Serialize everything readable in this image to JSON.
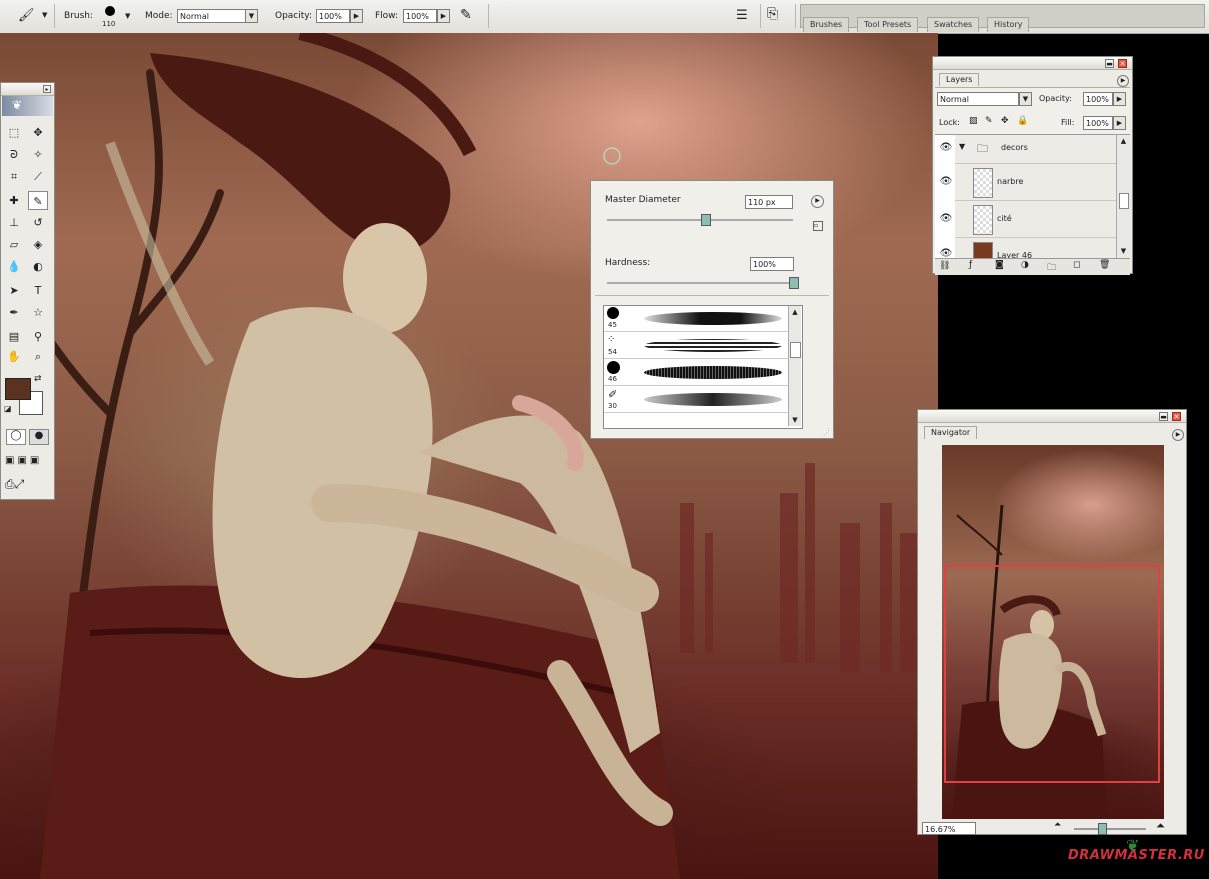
{
  "optionsbar": {
    "brush_label": "Brush:",
    "brush_size": "110",
    "mode_label": "Mode:",
    "mode_value": "Normal",
    "opacity_label": "Opacity:",
    "opacity_value": "100%",
    "flow_label": "Flow:",
    "flow_value": "100%",
    "well_tabs": [
      "Brushes",
      "Tool Presets",
      "Swatches",
      "History"
    ]
  },
  "brush_popup": {
    "master_diameter_label": "Master Diameter",
    "master_diameter_value": "110 px",
    "hardness_label": "Hardness:",
    "hardness_value": "100%",
    "presets": [
      {
        "size": "45"
      },
      {
        "size": "54"
      },
      {
        "size": "46"
      },
      {
        "size": "30"
      }
    ]
  },
  "layers": {
    "tab": "Layers",
    "blend_mode": "Normal",
    "opacity_label": "Opacity:",
    "opacity_value": "100%",
    "lock_label": "Lock:",
    "fill_label": "Fill:",
    "fill_value": "100%",
    "items": [
      {
        "name": "decors"
      },
      {
        "name": "narbre"
      },
      {
        "name": "cité"
      },
      {
        "name": "Layer 46"
      }
    ]
  },
  "navigator": {
    "tab": "Navigator",
    "zoom": "16.67%"
  },
  "watermark": "DRAWMASTER.RU",
  "colors": {
    "foreground": "#5a3220",
    "background": "#ffffff",
    "nav_view_box": "#e04040",
    "canvas_bg": "#000000"
  },
  "icons": [
    "brush-icon",
    "palette-well-icon",
    "airbrush-icon",
    "eye-icon",
    "folder-icon",
    "link-icon",
    "trash-icon",
    "new-layer-icon"
  ]
}
